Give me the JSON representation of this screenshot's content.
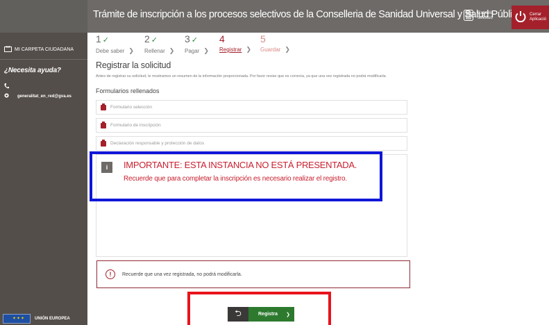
{
  "header": {
    "title": "Trámite de inscripción a los procesos selectivos de la Conselleria de Sanidad Universal y Salud Pública",
    "cancel_label_line1": "Cancela",
    "cancel_label_line2": "solicitud",
    "close_label_line1": "Cerrar",
    "close_label_line2": "Aplicació"
  },
  "sidebar": {
    "my_folder": "MI CARPETA CIUDADANA",
    "help_title": "¿Necesita ayuda?",
    "email": "generalitat_en_red@gva.es",
    "eu_label": "UNIÓN EUROPEA"
  },
  "steps": [
    {
      "number": "1",
      "label": "Debe saber",
      "state": "done"
    },
    {
      "number": "2",
      "label": "Rellenar",
      "state": "done"
    },
    {
      "number": "3",
      "label": "Pagar",
      "state": "done"
    },
    {
      "number": "4",
      "label": "Registrar",
      "state": "active"
    },
    {
      "number": "5",
      "label": "Guardar",
      "state": "pending"
    }
  ],
  "main": {
    "section_title": "Registrar la solicitud",
    "intro": "Antes de registrar su solicitud, le mostramos un resumen de la información proporcionada. Por favor revise que es correcta, ya que una vez registrada no podrá modificarla.",
    "forms_title": "Formularios rellenados",
    "forms": [
      "Formulario selección",
      "Formulario de inscripción",
      "Declaración responsable y protección de datos"
    ],
    "notice_heading": "IMPORTANTE: ESTA INSTANCIA NO ESTÁ PRESENTADA.",
    "notice_body": "Recuerde que para completar la inscripción es necesario realizar el registro.",
    "warning": "Recuerde que una vez registrada, no podrá modificarla.",
    "register_label": "Registra"
  },
  "colors": {
    "header_bg": "#6d6a67",
    "sidebar_bg": "#544e4a",
    "accent_red": "#a4202b",
    "register_green": "#2d7a2f",
    "highlight_blue": "#1016d8",
    "highlight_red": "#e8131b"
  },
  "icons": {
    "folder": "folder-icon",
    "phone": "phone-icon",
    "globe": "globe-icon",
    "trash": "trash-icon",
    "power": "power-icon",
    "form": "document-icon",
    "info": "info-icon",
    "warning": "exclamation-circle-icon",
    "back": "back-arrow-icon",
    "next": "chevron-right-icon"
  }
}
